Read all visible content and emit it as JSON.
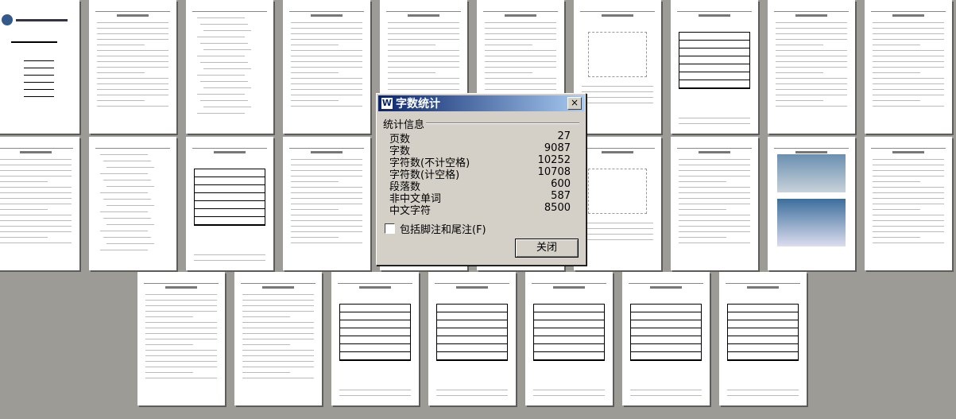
{
  "pages": [
    {
      "kind": "cover"
    },
    {
      "kind": "text"
    },
    {
      "kind": "toc"
    },
    {
      "kind": "text"
    },
    {
      "kind": "text"
    },
    {
      "kind": "text"
    },
    {
      "kind": "figure"
    },
    {
      "kind": "table"
    },
    {
      "kind": "text"
    },
    {
      "kind": "text"
    },
    {
      "kind": "text"
    },
    {
      "kind": "toc"
    },
    {
      "kind": "table"
    },
    {
      "kind": "text"
    },
    {
      "kind": "text"
    },
    {
      "kind": "text"
    },
    {
      "kind": "figure"
    },
    {
      "kind": "text"
    },
    {
      "kind": "image"
    },
    {
      "kind": "text"
    },
    {
      "kind": "text"
    },
    {
      "kind": "text"
    },
    {
      "kind": "table"
    },
    {
      "kind": "table"
    },
    {
      "kind": "table"
    },
    {
      "kind": "table"
    },
    {
      "kind": "table"
    }
  ],
  "dialog": {
    "title": "字数统计",
    "group": "统计信息",
    "stats": [
      {
        "label": "页数",
        "value": "27"
      },
      {
        "label": "字数",
        "value": "9087"
      },
      {
        "label": "字符数(不计空格)",
        "value": "10252"
      },
      {
        "label": "字符数(计空格)",
        "value": "10708"
      },
      {
        "label": "段落数",
        "value": "600"
      },
      {
        "label": "非中文单词",
        "value": "587"
      },
      {
        "label": "中文字符",
        "value": "8500"
      }
    ],
    "checkbox_label": "包括脚注和尾注(F)",
    "close_label": "关闭",
    "close_x": "×"
  }
}
